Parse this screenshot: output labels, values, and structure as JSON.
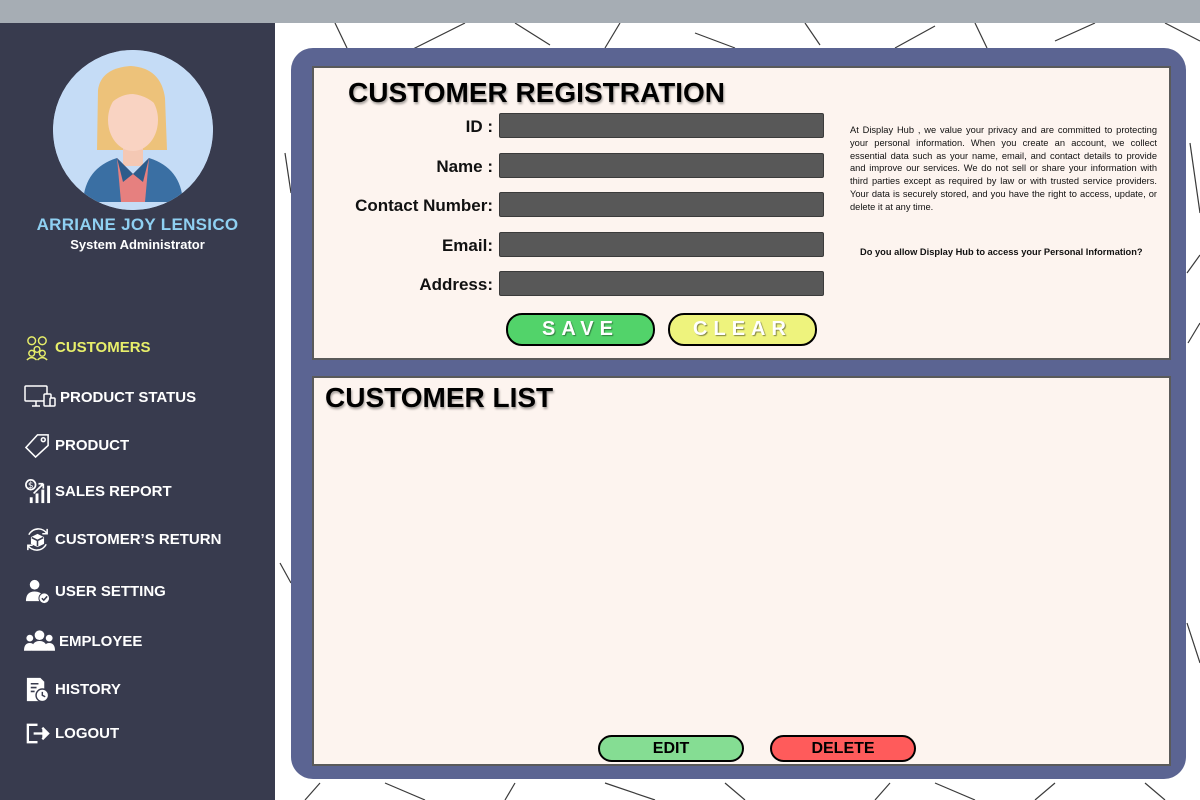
{
  "user": {
    "name": "ARRIANE JOY LENSICO",
    "role": "System Administrator"
  },
  "nav": {
    "items": [
      {
        "label": "CUSTOMERS",
        "icon": "customers-icon",
        "active": true
      },
      {
        "label": "PRODUCT STATUS",
        "icon": "monitor-devices-icon",
        "active": false
      },
      {
        "label": "PRODUCT",
        "icon": "tag-icon",
        "active": false
      },
      {
        "label": "SALES REPORT",
        "icon": "sales-chart-icon",
        "active": false
      },
      {
        "label": "CUSTOMER’S RETURN",
        "icon": "return-box-icon",
        "active": false
      },
      {
        "label": "USER SETTING",
        "icon": "user-check-icon",
        "active": false
      },
      {
        "label": "EMPLOYEE",
        "icon": "group-icon",
        "active": false
      },
      {
        "label": "HISTORY",
        "icon": "history-icon",
        "active": false
      },
      {
        "label": "LOGOUT",
        "icon": "logout-icon",
        "active": false
      }
    ]
  },
  "registration": {
    "title": "CUSTOMER REGISTRATION",
    "fields": [
      {
        "label": "ID :",
        "value": ""
      },
      {
        "label": "Name :",
        "value": ""
      },
      {
        "label": "Contact Number:",
        "value": ""
      },
      {
        "label": "Email:",
        "value": ""
      },
      {
        "label": "Address:",
        "value": ""
      }
    ],
    "save_label": "SAVE",
    "clear_label": "CLEAR",
    "privacy_text": "At Display Hub , we value your privacy and are committed to protecting your personal information. When you create an account, we collect essential data such as your name, email, and contact details to provide and improve our services. We do not sell or share your information with third parties except as required by law or with trusted service providers. Your data is securely stored, and you have the right to access, update, or delete it at any time.",
    "consent_question": "Do you allow Display Hub to access your Personal Information?"
  },
  "list": {
    "title": "CUSTOMER LIST",
    "edit_label": "EDIT",
    "delete_label": "DELETE"
  },
  "colors": {
    "sidebar": "#383b4e",
    "frame": "#5b6492",
    "card": "#fdf4ef",
    "active_nav": "#e8ef6a",
    "user_name": "#8fd0f2",
    "save": "#52d36a",
    "clear": "#eef37d",
    "edit": "#85dd93",
    "delete": "#ff5b5b"
  }
}
